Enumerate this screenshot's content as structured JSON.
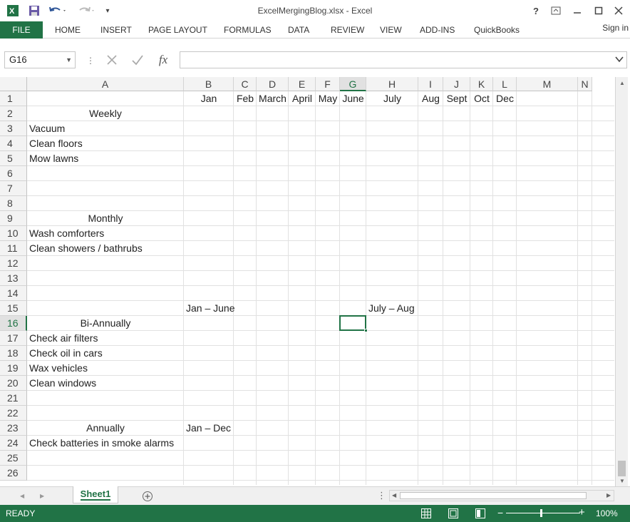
{
  "window": {
    "title": "ExcelMergingBlog.xlsx - Excel"
  },
  "ribbon": {
    "tabs": [
      "FILE",
      "HOME",
      "INSERT",
      "PAGE LAYOUT",
      "FORMULAS",
      "DATA",
      "REVIEW",
      "VIEW",
      "ADD-INS",
      "QuickBooks"
    ],
    "sign_in": "Sign in"
  },
  "formula_bar": {
    "name_box": "G16",
    "fx_label": "fx",
    "formula": ""
  },
  "sheet": {
    "columns": [
      "A",
      "B",
      "C",
      "D",
      "E",
      "F",
      "G",
      "H",
      "I",
      "J",
      "K",
      "L",
      "M",
      "N"
    ],
    "selected_column": "G",
    "rows": [
      "1",
      "2",
      "3",
      "4",
      "5",
      "6",
      "7",
      "8",
      "9",
      "10",
      "11",
      "12",
      "13",
      "14",
      "15",
      "16",
      "17",
      "18",
      "19",
      "20",
      "21",
      "22",
      "23",
      "24",
      "25",
      "26"
    ],
    "selected_row": "16",
    "cells": {
      "B1": "Jan",
      "C1": "Feb",
      "D1": "March",
      "E1": "April",
      "F1": "May",
      "G1": "June",
      "H1": "July",
      "I1": "Aug",
      "J1": "Sept",
      "K1": "Oct",
      "L1": "Dec",
      "A2": "Weekly",
      "A3": "Vacuum",
      "A4": "Clean floors",
      "A5": "Mow lawns",
      "A9": "Monthly",
      "A10": "Wash comforters",
      "A11": "Clean showers / bathrubs",
      "B15": "Jan – June",
      "H15": "July – Aug",
      "A16": "Bi-Annually",
      "A17": "Check air filters",
      "A18": "Check oil in cars",
      "A19": "Wax vehicles",
      "A20": "Clean windows",
      "A23": "Annually",
      "B23": "Jan – Dec",
      "A24": "Check batteries in smoke alarms"
    }
  },
  "sheet_tabs": {
    "active": "Sheet1"
  },
  "status": {
    "mode": "READY",
    "zoom": "100%"
  }
}
